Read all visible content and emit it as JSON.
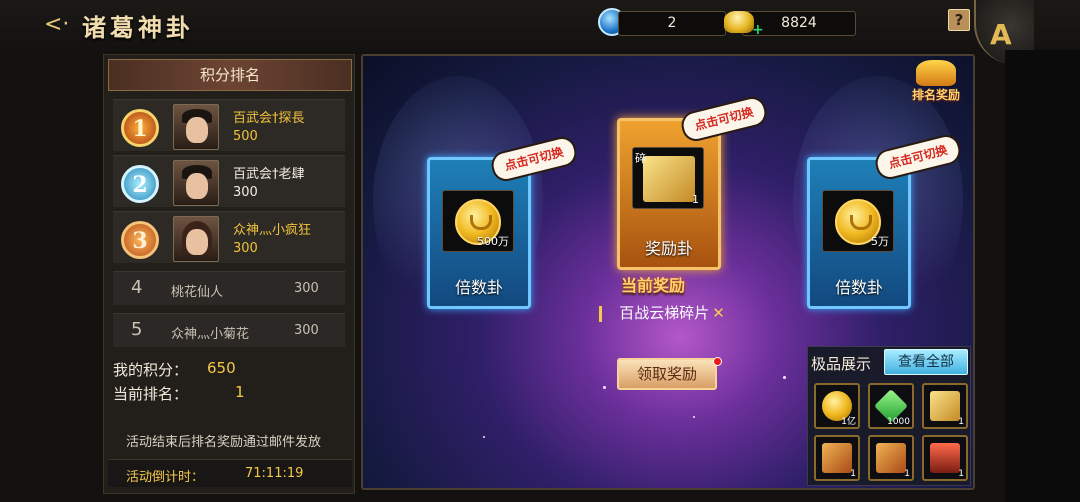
{
  "header": {
    "title": "诸葛神卦",
    "taiji_count": "2",
    "gold_count": "8824",
    "help": "?",
    "menu_letter": "A"
  },
  "ranking": {
    "title": "积分排名",
    "top": [
      {
        "rank": "1",
        "name": "百武会†探長",
        "score": "500",
        "name_color": "gold",
        "score_color": "gold"
      },
      {
        "rank": "2",
        "name": "百武会†老肆",
        "score": "300",
        "name_color": "white",
        "score_color": "white"
      },
      {
        "rank": "3",
        "name": "众神灬小疯狂",
        "score": "300",
        "name_color": "gold",
        "score_color": "gold"
      }
    ],
    "rest": [
      {
        "rank": "4",
        "name": "桃花仙人",
        "score": "300"
      },
      {
        "rank": "5",
        "name": "众神灬小菊花",
        "score": "300"
      }
    ],
    "my_score_label": "我的积分：",
    "my_score": "650",
    "my_rank_label": "当前排名：",
    "my_rank": "1",
    "note": "活动结束后排名奖励通过邮件发放",
    "countdown_label": "活动倒计时：",
    "countdown": "71:11:19"
  },
  "rewards": {
    "left_card": {
      "label": "倍数卦",
      "qty": "500万",
      "bubble": "点击可切换"
    },
    "center_card": {
      "label": "奖励卦",
      "qty": "1",
      "bubble": "点击可切换"
    },
    "right_card": {
      "label": "倍数卦",
      "qty": "5万",
      "bubble": "点击可切换"
    },
    "current_label": "当前奖励",
    "current_name": "百战云梯碎片",
    "cancel": "✕",
    "claim": "领取奖励",
    "rank_reward": "排名奖励"
  },
  "showcase": {
    "title": "极品展示",
    "view_all": "查看全部",
    "items": [
      {
        "icon": "coin-icon",
        "qty": "1亿"
      },
      {
        "icon": "gem-icon",
        "qty": "1000"
      },
      {
        "icon": "fragment-icon",
        "qty": "1"
      },
      {
        "icon": "cart-fragment-icon",
        "qty": "1"
      },
      {
        "icon": "cart-fragment-icon",
        "qty": "1"
      },
      {
        "icon": "house-fragment-icon",
        "qty": "1"
      }
    ]
  }
}
